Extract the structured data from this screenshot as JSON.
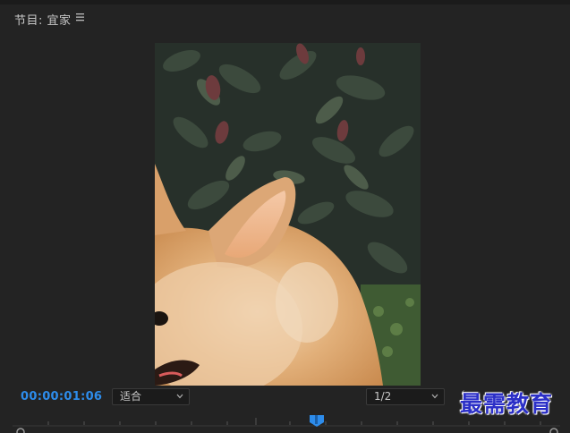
{
  "panel": {
    "title": "节目: 宜家",
    "menu_icon": "hamburger-menu-icon"
  },
  "viewer": {
    "frame_content": "corgi dog in front of leafy shrub"
  },
  "controls": {
    "timecode": "00:00:01:06",
    "zoom_select": "适合",
    "resolution_select": "1/2",
    "settings_icon": "wrench-icon"
  },
  "watermark": {
    "text": "最需教育"
  },
  "colors": {
    "timecode": "#2d8ceb",
    "playhead": "#2d8ceb",
    "panel_bg": "#232323",
    "watermark": "#2b2fc7"
  }
}
